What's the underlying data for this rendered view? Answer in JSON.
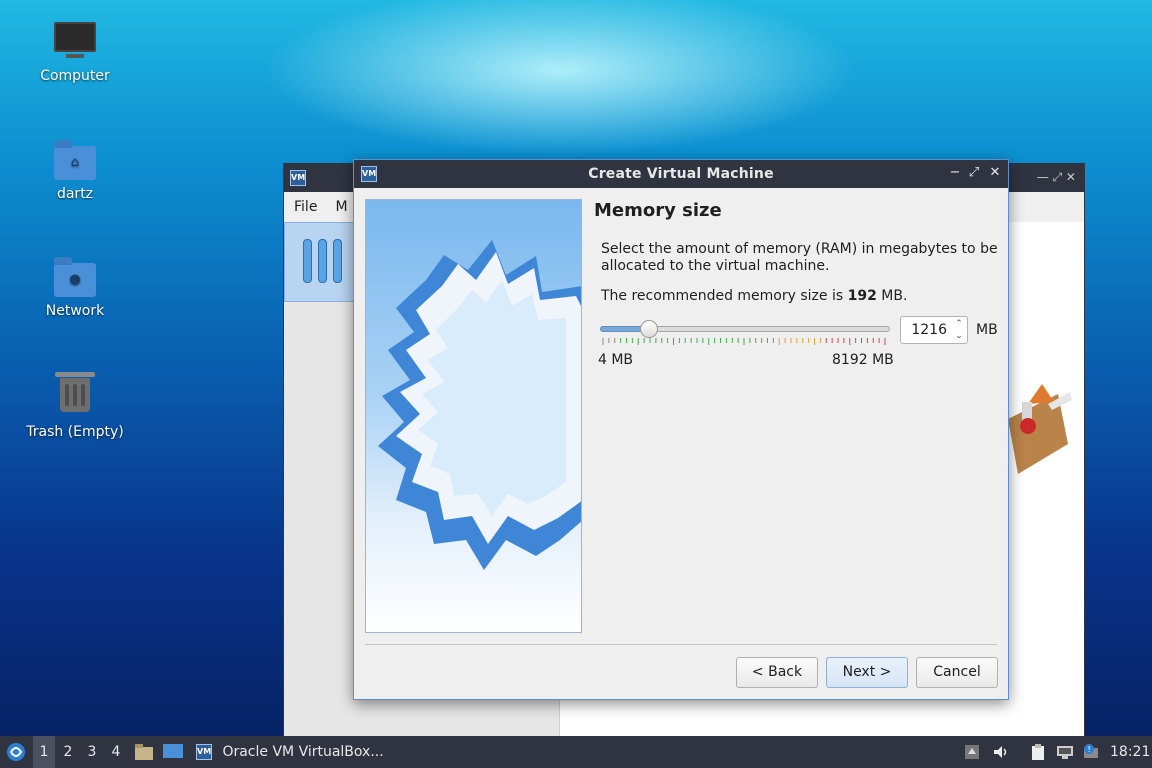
{
  "desktop": {
    "icons": [
      {
        "label": "Computer"
      },
      {
        "label": "dartz"
      },
      {
        "label": "Network"
      },
      {
        "label": "Trash (Empty)"
      }
    ]
  },
  "bg_window": {
    "menu": [
      "File",
      "M"
    ]
  },
  "dialog": {
    "title": "Create Virtual Machine",
    "page_title": "Memory size",
    "description": "Select the amount of memory (RAM) in megabytes to be allocated to the virtual machine.",
    "recommend_prefix": "The recommended memory size is",
    "recommend_value": "192",
    "recommend_suffix": "MB.",
    "memory_value": "1216",
    "memory_unit": "MB",
    "slider_fraction": 0.148,
    "range_min": "4 MB",
    "range_max": "8192 MB",
    "buttons": {
      "back": "< Back",
      "next": "Next >",
      "cancel": "Cancel"
    }
  },
  "taskbar": {
    "workspaces": [
      "1",
      "2",
      "3",
      "4"
    ],
    "active_workspace": "1",
    "app_label": "Oracle VM VirtualBox...",
    "clock": "18:21"
  },
  "colors": {
    "titlebar": "#2f3440",
    "accent": "#5b8fd0",
    "slider_fill": "#7aa7d6"
  }
}
